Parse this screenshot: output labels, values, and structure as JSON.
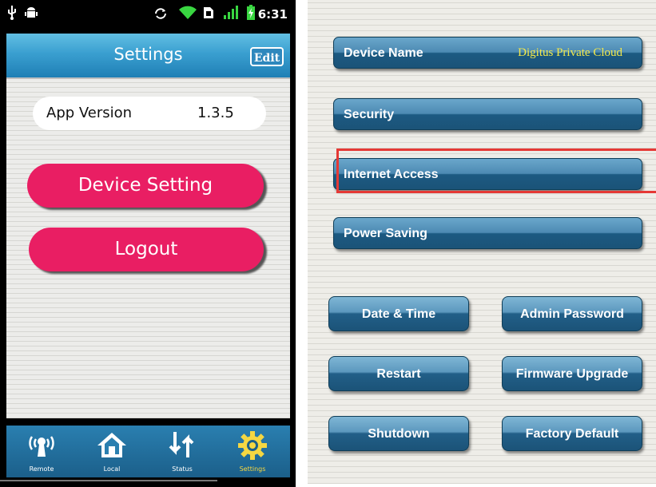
{
  "status_bar": {
    "time": "6:31"
  },
  "header": {
    "title": "Settings",
    "edit_label": "Edit"
  },
  "app_version": {
    "label": "App Version",
    "value": "1.3.5"
  },
  "buttons": {
    "device_setting": "Device Setting",
    "logout": "Logout"
  },
  "tabs": [
    {
      "label": "Remote",
      "icon": "antenna-icon"
    },
    {
      "label": "Local",
      "icon": "home-icon"
    },
    {
      "label": "Status",
      "icon": "updown-arrows-icon"
    },
    {
      "label": "Settings",
      "icon": "gear-icon",
      "active": true
    }
  ],
  "device_settings": {
    "device_name_label": "Device Name",
    "device_name_value": "Digitus Private Cloud",
    "security": "Security",
    "internet_access": "Internet Access",
    "power_saving": "Power Saving",
    "date_time": "Date & Time",
    "admin_password": "Admin Password",
    "restart": "Restart",
    "firmware_upgrade": "Firmware Upgrade",
    "shutdown": "Shutdown",
    "factory_default": "Factory Default"
  },
  "colors": {
    "accent_pink": "#e91e63",
    "header_blue": "#3a9fd0",
    "button_blue": "#1c5a82",
    "highlight_red": "#e53935",
    "device_name_yellow": "#f4e94a",
    "active_tab_yellow": "#f5d742"
  }
}
